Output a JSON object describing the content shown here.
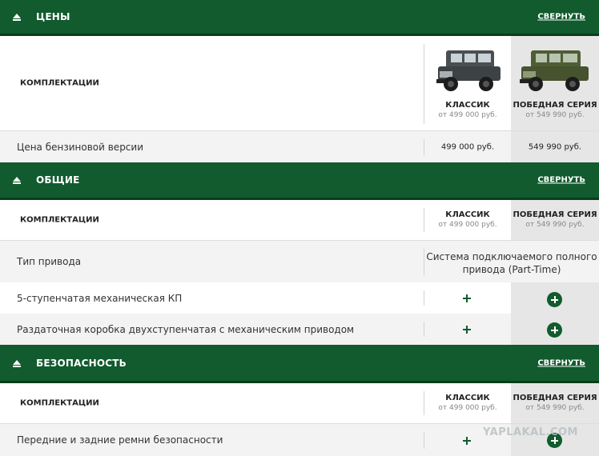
{
  "sections": [
    {
      "title": "ЦЕНЫ",
      "collapse": "СВЕРНУТЬ"
    },
    {
      "title": "ОБЩИЕ",
      "collapse": "СВЕРНУТЬ"
    },
    {
      "title": "БЕЗОПАСНОСТЬ",
      "collapse": "СВЕРНУТЬ"
    }
  ],
  "komplektacii_label": "КОМПЛЕКТАЦИИ",
  "trims": [
    {
      "name": "КЛАССИК",
      "price_from": "от 499 000 руб."
    },
    {
      "name": "ПОБЕДНАЯ СЕРИЯ",
      "price_from": "от 549 990 руб."
    }
  ],
  "prices": {
    "row_label": "Цена бензиновой версии",
    "values": [
      "499 000 руб.",
      "549 990 руб."
    ]
  },
  "general": {
    "drive_label": "Тип привода",
    "drive_value": "Система подключаемого полного привода (Part-Time)",
    "rows": [
      "5-ступенчатая механическая КП",
      "Раздаточная коробка двухступенчатая с механическим приводом"
    ]
  },
  "safety": {
    "rows": [
      "Передние и задние ремни безопасности"
    ]
  },
  "watermark": "YAPLAKAL.COM",
  "colors": {
    "brand_green": "#115b2e",
    "highlight_col": "#e6e6e6"
  },
  "icons": [
    "collapse-arrow-icon",
    "plus-icon",
    "plus-circle-icon"
  ]
}
